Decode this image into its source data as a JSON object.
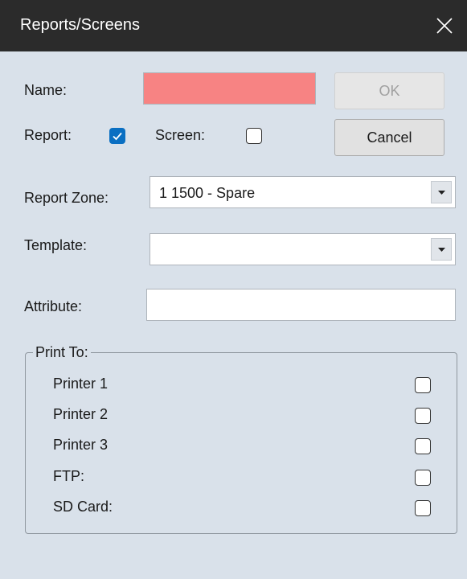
{
  "window": {
    "title": "Reports/Screens"
  },
  "form": {
    "name_label": "Name:",
    "name_value": "",
    "report_label": "Report:",
    "report_checked": true,
    "screen_label": "Screen:",
    "screen_checked": false,
    "report_zone_label": "Report Zone:",
    "report_zone_value": "1 1500 - Spare",
    "template_label": "Template:",
    "template_value": "",
    "attribute_label": "Attribute:",
    "attribute_value": ""
  },
  "buttons": {
    "ok_label": "OK",
    "cancel_label": "Cancel"
  },
  "print_to": {
    "legend": "Print To:",
    "items": [
      {
        "label": "Printer 1",
        "checked": false
      },
      {
        "label": "Printer 2",
        "checked": false
      },
      {
        "label": "Printer 3",
        "checked": false
      },
      {
        "label": "FTP:",
        "checked": false
      },
      {
        "label": "SD Card:",
        "checked": false
      }
    ]
  },
  "colors": {
    "titlebar": "#2b2b2b",
    "background": "#d9e1ea",
    "name_field_error": "#f78383",
    "checkbox_checked": "#0a6fc2"
  },
  "icons": {
    "close": "close-icon",
    "dropdown": "chevron-down-icon",
    "check": "checkmark-icon"
  }
}
